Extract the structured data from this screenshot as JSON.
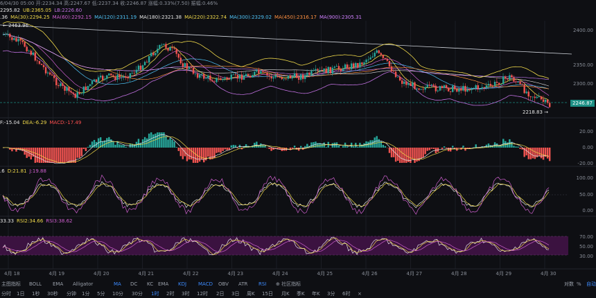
{
  "header": {
    "row1": "6/04/30 05:00  开:2234.34  高:2247.67  低:2237.34  收:2246.87  涨幅:0.33%(7.50)  振幅:0.46%",
    "row2_items": [
      {
        "text": "2295.82",
        "color": "#e6e6e6"
      },
      {
        "text": "UB:2365.05",
        "color": "#f0d94a"
      },
      {
        "text": "LB:2226.60",
        "color": "#c070e0"
      }
    ],
    "row3_items": [
      {
        "text": ".36",
        "color": "#e6e6e6"
      },
      {
        "text": "MA(30):2294.25",
        "color": "#f0d94a"
      },
      {
        "text": "MA(60):2292.15",
        "color": "#d060d0"
      },
      {
        "text": "MA(120):2311.19",
        "color": "#4fc3f7"
      },
      {
        "text": "MA(180):2321.38",
        "color": "#e6e6e6"
      },
      {
        "text": "MA(220):2322.74",
        "color": "#f0d94a"
      },
      {
        "text": "MA(300):2329.02",
        "color": "#4fc3f7"
      },
      {
        "text": "MA(450):2316.17",
        "color": "#ff9040"
      },
      {
        "text": "MA(900):2305.31",
        "color": "#d080ff"
      }
    ]
  },
  "main_chart": {
    "high_label": "2463.96",
    "low_label": "2218.83",
    "current_price": "2246.87",
    "y_ticks": [
      "2400.00",
      "2350.00",
      "2300.00"
    ]
  },
  "macd_panel": {
    "items": [
      {
        "text": "F:-15.04",
        "color": "#e6e6e6"
      },
      {
        "text": "DEA:-6.29",
        "color": "#f0d94a"
      },
      {
        "text": "MACD:-17.49",
        "color": "#ff5050"
      }
    ],
    "y_ticks": [
      "20.00",
      "0.00",
      "-20.00"
    ]
  },
  "kdj_panel": {
    "items": [
      {
        "text": ".6",
        "color": "#e6e6e6"
      },
      {
        "text": "D:21.81",
        "color": "#f0d94a"
      },
      {
        "text": "J:19.88",
        "color": "#d060d0"
      }
    ],
    "y_ticks": [
      "100.00",
      "50.00",
      "0.00"
    ]
  },
  "rsi_panel": {
    "items": [
      {
        "text": "33.33",
        "color": "#e6e6e6"
      },
      {
        "text": "RSI2:34.66",
        "color": "#f0d94a"
      },
      {
        "text": "RSI3:38.62",
        "color": "#d060d0"
      }
    ],
    "y_ticks": [
      "70.00",
      "50.00",
      "30.00"
    ]
  },
  "x_axis": [
    "4月 18",
    "4月 19",
    "4月 20",
    "4月 21",
    "4月 22",
    "4月 23",
    "4月 24",
    "4月 25",
    "4月 26",
    "4月 27",
    "4月 28",
    "4月 29",
    "4月 30"
  ],
  "indicator_tabs": {
    "main": [
      "主图指标",
      "BOLL",
      "EMA",
      "Alligator",
      "MA",
      "DC",
      "KC"
    ],
    "sub": [
      "EMA",
      "KDJ",
      "MACD",
      "OBV",
      "ATR",
      "RSI"
    ],
    "community": "社区指标",
    "right": [
      "对数",
      "%",
      "自动"
    ]
  },
  "periods": [
    "分时",
    "1日",
    "1秒",
    "30秒",
    "分钟",
    "1分",
    "5分",
    "10分",
    "30分",
    "1时",
    "2时",
    "3时",
    "12时",
    "2日",
    "3日",
    "周K",
    "15日",
    "月K",
    "季K",
    "年K",
    "3分",
    "6时",
    "×"
  ],
  "active_period": "1时",
  "active_indicators": [
    "MA",
    "KDJ",
    "MACD",
    "RSI"
  ],
  "colors": {
    "up": "#26a69a",
    "down": "#ef5350",
    "background": "#0e0f13",
    "accent": "#3d8bff"
  }
}
